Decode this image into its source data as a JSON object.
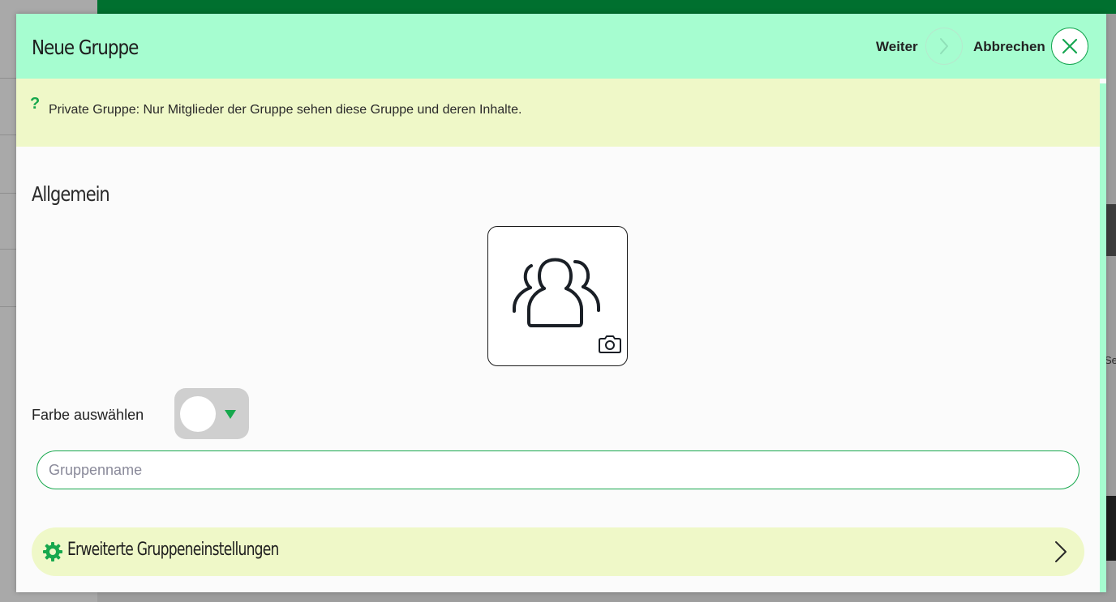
{
  "modal": {
    "title": "Neue Gruppe",
    "next_label": "Weiter",
    "cancel_label": "Abbrechen"
  },
  "info": {
    "icon": "?",
    "text": "Private Gruppe: Nur Mitglieder der Gruppe sehen diese Gruppe und deren Inhalte."
  },
  "general": {
    "title": "Allgemein",
    "avatar_icon": "group-icon",
    "camera_icon": "camera-icon",
    "color_label": "Farbe auswählen",
    "selected_color": "#ffffff",
    "name_placeholder": "Gruppenname",
    "name_value": ""
  },
  "advanced": {
    "label": "Erweiterte Gruppeneinstellungen"
  },
  "colors": {
    "header": "#a6fdd0",
    "accent": "#17a84d",
    "banner": "#eff8c8",
    "topbar": "#00702f"
  },
  "background": {
    "partial_text": "Se"
  }
}
